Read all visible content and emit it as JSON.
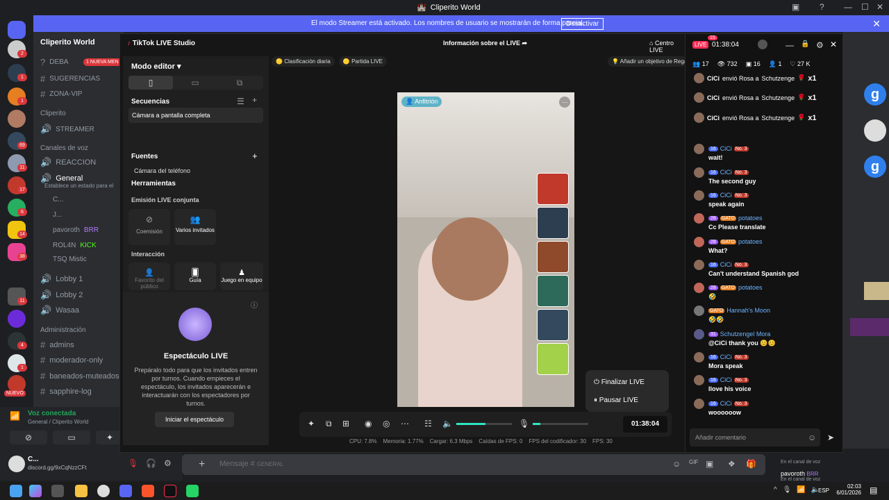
{
  "window": {
    "title": "Cliperito World"
  },
  "banner": {
    "message": "El modo Streamer está activado. Los nombres de usuario se mostrarán de forma parcial.",
    "button": "Desactivar"
  },
  "server": {
    "name": "Cliperito World",
    "new_badge": "1 NUEVA MEN",
    "new_label": "NUEVO"
  },
  "server_badges": [
    "2",
    "1",
    "1",
    "69",
    "11",
    "17",
    "6",
    "14",
    "38",
    "11",
    "4",
    "1"
  ],
  "channels": {
    "top": [
      {
        "name": "DEBA"
      },
      {
        "name": "SUGERENCIAS"
      },
      {
        "name": "ZONA-VIP"
      }
    ],
    "cat_cliperito": "Cliperito",
    "streamer": "STREAMER",
    "cat_voice": "Canales de voz",
    "reaccion": "REACCION",
    "general": "General",
    "general_status": "Establece un estado para el",
    "voice_users": [
      {
        "name": "C..."
      },
      {
        "name": "J..."
      },
      {
        "name": "pavoroth",
        "badge": "BRR"
      },
      {
        "name": "ROL4N",
        "badge": "KICK"
      },
      {
        "name": "TSQ Mistic"
      }
    ],
    "lobby1": "Lobby 1",
    "lobby2": "Lobby 2",
    "wasaa": "Wasaa",
    "cat_admin": "Administración",
    "admin": [
      "admins",
      "moderador-only",
      "baneados-muteados",
      "sapphire-log"
    ]
  },
  "voice": {
    "status": "Voz conectada",
    "location": "General / Cliperito World"
  },
  "user": {
    "name": "C...",
    "status": "discord.gg/9xCqNzzCFt"
  },
  "message_input": {
    "placeholder": "Mensaje #",
    "channel": "GENERAL"
  },
  "studio": {
    "app_name": "TikTok LIVE Studio",
    "live_info": "Información sobre el LIVE",
    "center": "Centro LIVE",
    "mode_editor": "Modo editor",
    "sequences": "Secuencias",
    "seq_item": "Cámara a pantalla completa",
    "sources": "Fuentes",
    "source_item": "Cámara del teléfono",
    "tools": "Herramientas",
    "coemission": "Emisión LIVE conjunta",
    "tile_coemision": "Coemisión",
    "tile_multi": "Varios invitados",
    "interaction": "Interacción",
    "tile_fav": "Favorito del público",
    "tile_guide": "Guía",
    "tile_team": "Juego en equipo",
    "show_title": "Espectáculo LIVE",
    "show_desc": "Prepáralo todo para que los invitados entren por turnos. Cuando empieces el espectáculo, los invitados aparecerán e interactuarán con los espectadores por turnos.",
    "show_button": "Iniciar el espectáculo",
    "pill_rank": "Clasificación diaria",
    "pill_match": "Partida LIVE",
    "pill_goal": "Añadir un objetivo de Rega",
    "host_badge": "Anfitrión",
    "end_live": "Finalizar LIVE",
    "pause_live": "Pausar LIVE",
    "timer": "01:38:04",
    "stats": {
      "cpu": "CPU: 7.8%",
      "mem": "Memoria: 1.77%",
      "load": "Cargar: 6.3 Mbps",
      "drops": "Caídas de FPS: 0",
      "enc": "FPS del codificador: 30",
      "fps": "FPS: 30"
    }
  },
  "chat": {
    "live_badge": "LIVE",
    "timer": "01:38:04",
    "count_badge": "15",
    "stats": {
      "viewers_a": "17",
      "views": "732",
      "shares": "16",
      "users": "1",
      "likes": "27 K"
    },
    "gifts": [
      {
        "user": "CiCi",
        "text": "envió Rosa a",
        "target": "Schutzenge",
        "mult": "x1"
      },
      {
        "user": "CiCi",
        "text": "envió Rosa a",
        "target": "Schutzenge",
        "mult": "x1"
      },
      {
        "user": "CiCi",
        "text": "envió Rosa a",
        "target": "Schutzenge",
        "mult": "x1"
      }
    ],
    "messages": [
      {
        "lvl": "16",
        "name": "CiCi",
        "tag": "No. 3",
        "text": "wait!"
      },
      {
        "lvl": "16",
        "name": "CiCi",
        "tag": "No. 3",
        "text": "The second guy"
      },
      {
        "lvl": "16",
        "name": "CiCi",
        "tag": "No. 3",
        "text": "speak again"
      },
      {
        "lvl": "28",
        "name": "potatoes",
        "tag": "GATO",
        "text": "Cc Please translate"
      },
      {
        "lvl": "28",
        "name": "potatoes",
        "tag": "GATO",
        "text": "What?"
      },
      {
        "lvl": "16",
        "name": "CiCi",
        "tag": "No. 3",
        "text": "Can't understand Spanish god"
      },
      {
        "lvl": "28",
        "name": "potatoes",
        "tag": "GATO",
        "text": "🤣"
      },
      {
        "lvl": "",
        "name": "Hannah's Moon",
        "tag": "GATO",
        "text": "🤣🤣"
      },
      {
        "lvl": "31",
        "name": "Schutzengel Mora",
        "tag": "",
        "text": "@CiCi thank you 😊😊"
      },
      {
        "lvl": "16",
        "name": "CiCi",
        "tag": "No. 3",
        "text": "Mora speak"
      },
      {
        "lvl": "16",
        "name": "CiCi",
        "tag": "No. 3",
        "text": "Ilove his voice"
      },
      {
        "lvl": "16",
        "name": "CiCi",
        "tag": "No. 3",
        "text": "woooooow"
      }
    ],
    "input_placeholder": "Añadir comentario"
  },
  "right_users": [
    {
      "name": "pavoroth",
      "badge": "BRR",
      "status": "En el canal de voz"
    },
    {
      "name": "",
      "status": "En el canal de voz"
    }
  ],
  "taskbar": {
    "lang": "ESP",
    "time": "02:03",
    "date": "6/01/2026"
  }
}
